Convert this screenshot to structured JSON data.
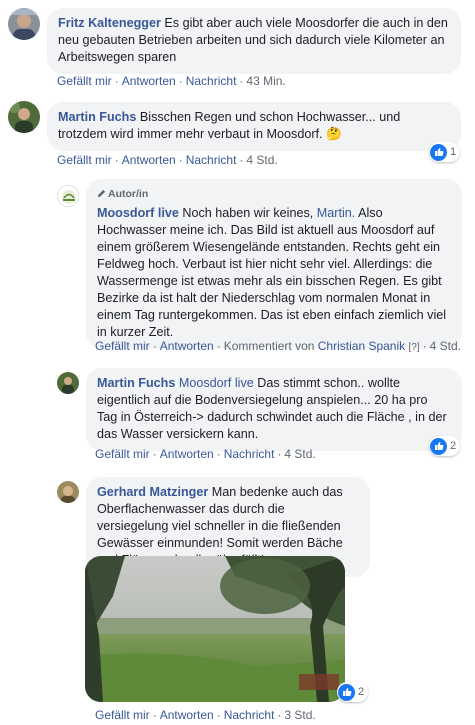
{
  "comments": [
    {
      "author": "Fritz Kaltenegger",
      "text": "Es gibt aber auch viele Moosdorfer die auch in den neu gebauten Betrieben arbeiten und sich dadurch viele Kilometer an Arbeitswegen sparen",
      "like": "Gefällt mir",
      "reply": "Antworten",
      "message": "Nachricht",
      "time": "43 Min."
    },
    {
      "author": "Martin Fuchs",
      "text": "Bisschen Regen und schon Hochwasser... und trotzdem wird immer mehr verbaut in Moosdorf. 🤔",
      "like": "Gefällt mir",
      "reply": "Antworten",
      "message": "Nachricht",
      "time": "4 Std.",
      "reactions": "1"
    }
  ],
  "replies": [
    {
      "badge": "Autor/in",
      "author": "Moosdorf live",
      "text_before": "Noch haben wir keines,",
      "mention": "Martin.",
      "text_after": "Also Hochwasser meine ich. Das Bild ist aktuell aus Moosdorf auf einem größerem Wiesengelände entstanden. Rechts geht ein Feldweg hoch. Verbaut ist hier nicht sehr viel. Allerdings: die Wassermenge ist etwas mehr als ein bisschen Regen. Es gibt Bezirke da ist halt der Niederschlag vom normalen Monat in einem Tag runtergekommen. Das ist eben einfach ziemlich viel in kurzer Zeit.",
      "like": "Gefällt mir",
      "reply": "Antworten",
      "commented_by_prefix": "Kommentiert von",
      "commented_by": "Christian Spanik",
      "help": "[?]",
      "time": "4 Std."
    },
    {
      "author": "Martin Fuchs",
      "mention": "Moosdorf live",
      "text": "Das stimmt schon.. wollte eigentlich auf die Bodenversiegelung anspielen... 20 ha pro Tag in Österreich-> dadurch schwindet auch die Fläche , in der das Wasser versickern kann.",
      "like": "Gefällt mir",
      "reply": "Antworten",
      "message": "Nachricht",
      "time": "4 Std.",
      "reactions": "2"
    },
    {
      "author": "Gerhard Matzinger",
      "text": "Man bedenke auch das Oberflachenwasser das durch die versiegelung viel schneller in die fließenden Gewässer einmunden! Somit werden Bäche und Flüsse schneller überfüllt!",
      "like": "Gefällt mir",
      "reply": "Antworten",
      "message": "Nachricht",
      "time": "3 Std.",
      "reactions": "2"
    }
  ],
  "colors": {
    "link": "#385898",
    "bubble": "#f2f3f5",
    "like": "#1877f2",
    "meta": "#606770"
  }
}
